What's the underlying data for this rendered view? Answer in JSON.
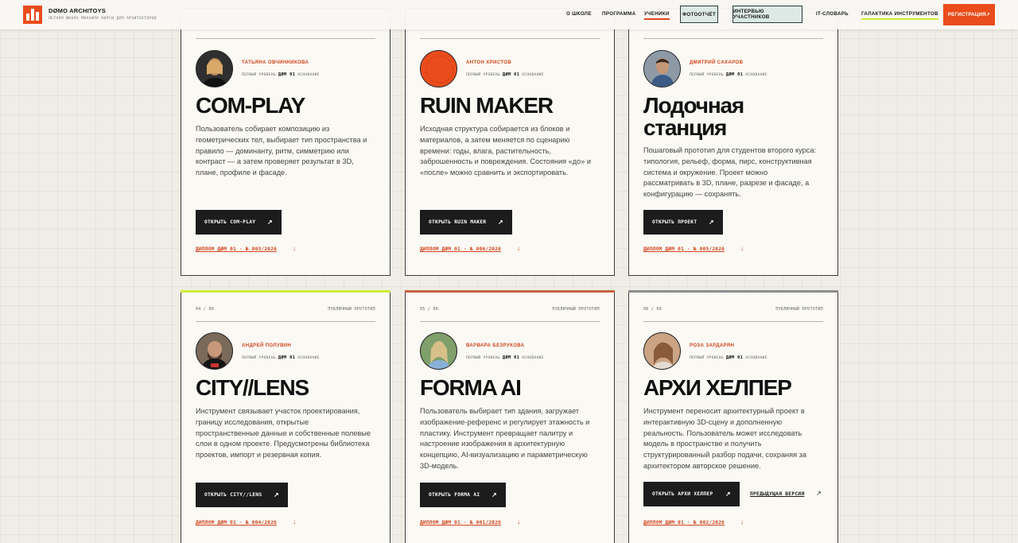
{
  "header": {
    "brand_title": "DØMO ARCHITOYS",
    "brand_subtitle": "ЛЕТНЯЯ ШКОЛА МИХАИЛА КОРСИ ДЛЯ АРХИТЕКТОРОВ",
    "nav": {
      "about": "О ШКОЛЕ",
      "program": "ПРОГРАММА",
      "students": "УЧЕНИКИ",
      "photo_report": "ФОТООТЧЁТ",
      "interviews": "ИНТЕРВЬЮ УЧАСТНИКОВ",
      "it_dictionary": "IT-СЛОВАРЬ",
      "galaxy": "ГАЛАКТИКА ИНСТРУМЕНТОВ",
      "register": "РЕГИСТРАЦИЯ↗"
    }
  },
  "colors": {
    "accent": "#ea4c1c",
    "lime": "#cfee3a",
    "rust": "#c4643f",
    "gray": "#8d8d8d"
  },
  "cards": [
    {
      "author": "ТАТЬЯНА ОВЧИННИКОВА",
      "level": "ПЕРВЫЙ УРОВЕНЬ",
      "code": "ДØМ 01",
      "base": "ОСНОВАНИЕ",
      "title": "COM-PLAY",
      "desc": "Пользователь собирает композицию из геометрических тел, выбирает тип пространства и правило — доминанту, ритм, симметрию или контраст — а затем проверяет результат в 3D, плане, профиле и фасаде.",
      "button": "ОТКРЫТЬ COM-PLAY",
      "diploma": "ДИПЛОМ ДØМ 01 · № 003/2026"
    },
    {
      "author": "АНТОН ХРИСТОВ",
      "level": "ПЕРВЫЙ УРОВЕНЬ",
      "code": "ДØМ 01",
      "base": "ОСНОВАНИЕ",
      "title": "RUIN MAKER",
      "desc": "Исходная структура собирается из блоков и материалов, а затем меняется по сценарию времени: годы, влага, растительность, заброшенность и повреждения. Состояния «до» и «после» можно сравнить и экспортировать.",
      "button": "ОТКРЫТЬ RUIN MAKER",
      "diploma": "ДИПЛОМ ДØМ 01 · № 006/2026"
    },
    {
      "author": "ДМИТРИЙ САХАРОВ",
      "level": "ПЕРВЫЙ УРОВЕНЬ",
      "code": "ДØМ 01",
      "base": "ОСНОВАНИЕ",
      "title": "Лодочная станция",
      "desc": "Пошаговый прототип для студентов второго курса: типология, рельеф, форма, пирс, конструктивная система и окружение. Проект можно рассматривать в 3D, плане, разрезе и фасаде, а конфигурацию — сохранять.",
      "button": "ОТКРЫТЬ ПРОЕКТ",
      "diploma": "ДИПЛОМ ДØМ 01 · № 005/2026"
    },
    {
      "index": "04 / 06",
      "tag": "ПУБЛИЧНЫЙ ПРОТОТИП",
      "author": "АНДРЕЙ ПОЛУВИН",
      "level": "ПЕРВЫЙ УРОВЕНЬ",
      "code": "ДØМ 01",
      "base": "ОСНОВАНИЕ",
      "title": "CITY//LENS",
      "desc": "Инструмент связывает участок проектирования, границу исследования, открытые пространственные данные и собственные полевые слои в одном проекте. Предусмотрены библиотека проектов, импорт и резервная копия.",
      "button": "ОТКРЫТЬ CITY//LENS",
      "diploma": "ДИПЛОМ ДØМ 01 · № 004/2026"
    },
    {
      "index": "05 / 06",
      "tag": "ПУБЛИЧНЫЙ ПРОТОТИП",
      "author": "ВАРВАРА БЕЗРУКОВА",
      "level": "ПЕРВЫЙ УРОВЕНЬ",
      "code": "ДØМ 01",
      "base": "ОСНОВАНИЕ",
      "title": "FORMA AI",
      "desc": "Пользователь выбирает тип здания, загружает изображение-референс и регулирует этажность и пластику. Инструмент превращает палитру и настроение изображения в архитектурную концепцию, AI-визуализацию и параметрическую 3D-модель.",
      "button": "ОТКРЫТЬ FORMA AI",
      "diploma": "ДИПЛОМ ДØМ 01 · № 001/2026"
    },
    {
      "index": "06 / 06",
      "tag": "ПУБЛИЧНЫЙ ПРОТОТИП",
      "author": "РОЗА ЗАРДАРЯН",
      "level": "ПЕРВЫЙ УРОВЕНЬ",
      "code": "ДØМ 01",
      "base": "ОСНОВАНИЕ",
      "title": "АРХИ ХЕЛПЕР",
      "desc": "Инструмент переносит архитектурный проект в интерактивную 3D-сцену и дополненную реальность. Пользователь может исследовать модель в пространстве и получить структурированный разбор подачи, сохраняя за архитектором авторское решение.",
      "button": "ОТКРЫТЬ АРХИ ХЕЛПЕР",
      "prev_version": "ПРЕДЫДУЩАЯ ВЕРСИЯ",
      "diploma": "ДИПЛОМ ДØМ 01 · № 002/2026"
    }
  ]
}
